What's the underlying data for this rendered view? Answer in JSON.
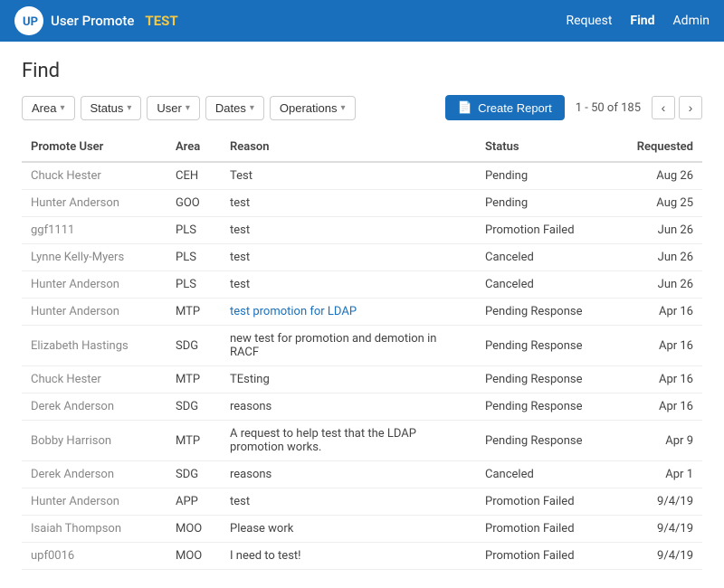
{
  "header": {
    "logo_text": "UP",
    "app_name": "User Promote",
    "env_label": "TEST",
    "nav": [
      {
        "label": "Request",
        "active": false
      },
      {
        "label": "Find",
        "active": true
      },
      {
        "label": "Admin",
        "active": false
      }
    ]
  },
  "page": {
    "title": "Find"
  },
  "filters": [
    {
      "label": "Area",
      "name": "area-filter"
    },
    {
      "label": "Status",
      "name": "status-filter"
    },
    {
      "label": "User",
      "name": "user-filter"
    },
    {
      "label": "Dates",
      "name": "dates-filter"
    },
    {
      "label": "Operations",
      "name": "operations-filter"
    }
  ],
  "toolbar": {
    "create_report_label": "Create Report",
    "pagination": {
      "current": "1 - 50 of 185"
    }
  },
  "table": {
    "columns": [
      "Promote User",
      "Area",
      "Reason",
      "Status",
      "Requested"
    ],
    "rows": [
      {
        "user": "Chuck Hester",
        "area": "CEH",
        "reason": "Test",
        "reason_link": false,
        "status": "Pending",
        "requested": "Aug 26"
      },
      {
        "user": "Hunter Anderson",
        "area": "GOO",
        "reason": "test",
        "reason_link": false,
        "status": "Pending",
        "requested": "Aug 25"
      },
      {
        "user": "ggf1111",
        "area": "PLS",
        "reason": "test",
        "reason_link": false,
        "status": "Promotion Failed",
        "requested": "Jun 26"
      },
      {
        "user": "Lynne Kelly-Myers",
        "area": "PLS",
        "reason": "test",
        "reason_link": false,
        "status": "Canceled",
        "requested": "Jun 26"
      },
      {
        "user": "Hunter Anderson",
        "area": "PLS",
        "reason": "test",
        "reason_link": false,
        "status": "Canceled",
        "requested": "Jun 26"
      },
      {
        "user": "Hunter Anderson",
        "area": "MTP",
        "reason": "test promotion for LDAP",
        "reason_link": true,
        "status": "Pending Response",
        "requested": "Apr 16"
      },
      {
        "user": "Elizabeth Hastings",
        "area": "SDG",
        "reason": "new test for promotion and demotion in RACF",
        "reason_link": false,
        "status": "Pending Response",
        "requested": "Apr 16"
      },
      {
        "user": "Chuck Hester",
        "area": "MTP",
        "reason": "TEsting",
        "reason_link": false,
        "status": "Pending Response",
        "requested": "Apr 16"
      },
      {
        "user": "Derek Anderson",
        "area": "SDG",
        "reason": "reasons",
        "reason_link": false,
        "status": "Pending Response",
        "requested": "Apr 16"
      },
      {
        "user": "Bobby Harrison",
        "area": "MTP",
        "reason": "A request to help test that the LDAP promotion works.",
        "reason_link": false,
        "status": "Pending Response",
        "requested": "Apr 9"
      },
      {
        "user": "Derek Anderson",
        "area": "SDG",
        "reason": "reasons",
        "reason_link": false,
        "status": "Canceled",
        "requested": "Apr 1"
      },
      {
        "user": "Hunter Anderson",
        "area": "APP",
        "reason": "test",
        "reason_link": false,
        "status": "Promotion Failed",
        "requested": "9/4/19"
      },
      {
        "user": "Isaiah Thompson",
        "area": "MOO",
        "reason": "Please work",
        "reason_link": false,
        "status": "Promotion Failed",
        "requested": "9/4/19"
      },
      {
        "user": "upf0016",
        "area": "MOO",
        "reason": "I need to test!",
        "reason_link": false,
        "status": "Promotion Failed",
        "requested": "9/4/19"
      }
    ]
  }
}
